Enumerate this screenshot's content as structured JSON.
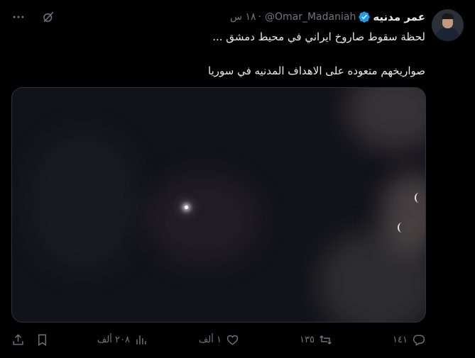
{
  "author": {
    "name": "عمر مدنيه",
    "handle": "@Omar_Madaniah",
    "separator": "·",
    "time": "١٨ س"
  },
  "tweet": {
    "line1": "لحظة سقوط صاروخ ايراني في محيط دمشق ...",
    "line2": "صواريخهم متعوده على الاهداف المدنيه في سوريا"
  },
  "metrics": {
    "replies": "١٤١",
    "retweets": "١٣٥",
    "likes": "١ ألف",
    "views": "٢٠٨ ألف"
  },
  "icons": {
    "verified": "verified-badge-icon",
    "grok": "grok-icon",
    "more": "more-icon",
    "reply": "reply-icon",
    "retweet": "retweet-icon",
    "like": "heart-icon",
    "views": "views-icon",
    "bookmark": "bookmark-icon",
    "share": "share-icon"
  },
  "colors": {
    "background": "#000000",
    "text": "#e7e9ea",
    "muted": "#71767b",
    "verified": "#1d9bf0"
  }
}
